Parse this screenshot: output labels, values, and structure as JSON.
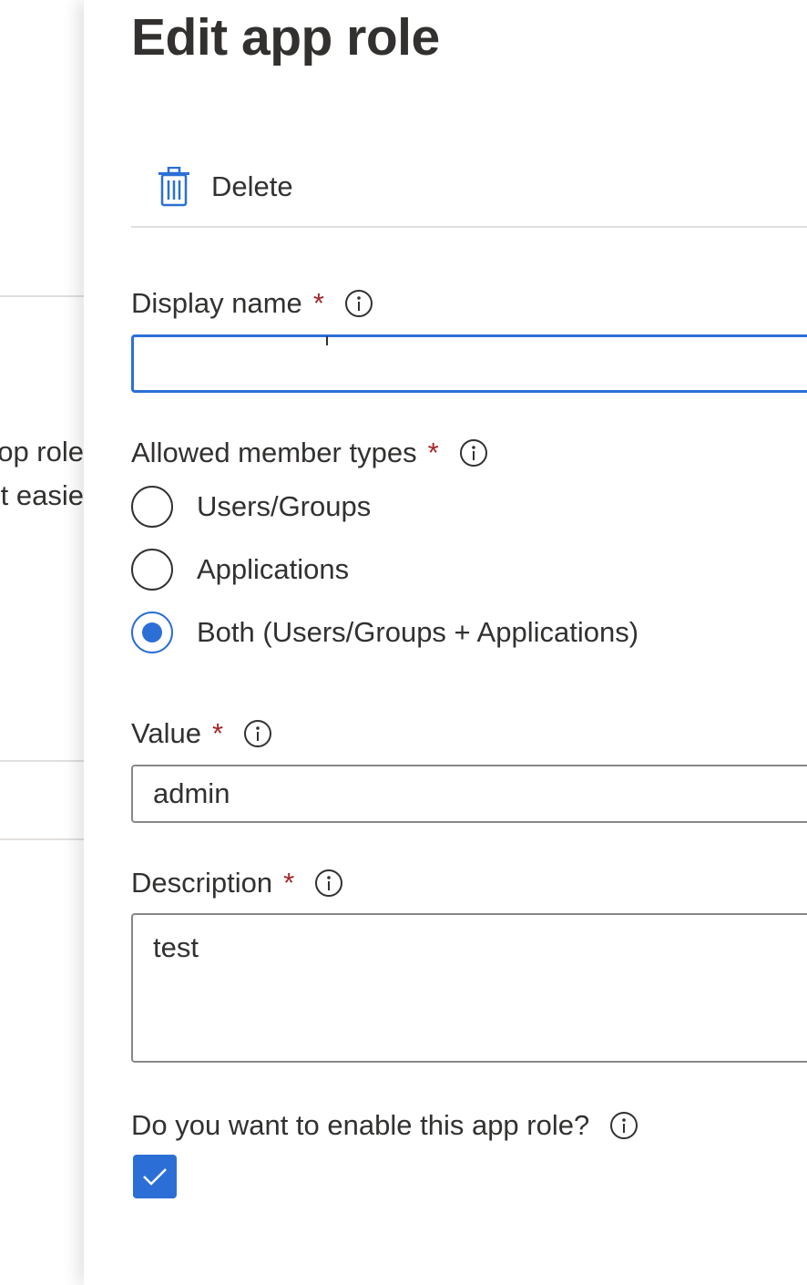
{
  "background_page": {
    "fragment_line1": "op role",
    "fragment_line2": "t easie"
  },
  "blade": {
    "title": "Edit app role",
    "toolbar": {
      "delete_label": "Delete",
      "delete_icon": "trash-icon"
    },
    "display_name": {
      "label": "Display name",
      "required_mark": "*",
      "info_icon": "info-icon",
      "value": "",
      "focused": true
    },
    "member_types": {
      "label": "Allowed member types",
      "required_mark": "*",
      "info_icon": "info-icon",
      "options": [
        {
          "label": "Users/Groups",
          "selected": false
        },
        {
          "label": "Applications",
          "selected": false
        },
        {
          "label": "Both (Users/Groups + Applications)",
          "selected": true
        }
      ]
    },
    "value_field": {
      "label": "Value",
      "required_mark": "*",
      "info_icon": "info-icon",
      "value": "admin"
    },
    "description": {
      "label": "Description",
      "required_mark": "*",
      "info_icon": "info-icon",
      "value": "test"
    },
    "enable": {
      "label": "Do you want to enable this app role?",
      "info_icon": "info-icon",
      "checked": true
    }
  },
  "colors": {
    "accent": "#2b6fd6",
    "required": "#a4262c",
    "text": "#323130",
    "border": "#8a8886",
    "divider": "#e1dfdd"
  }
}
